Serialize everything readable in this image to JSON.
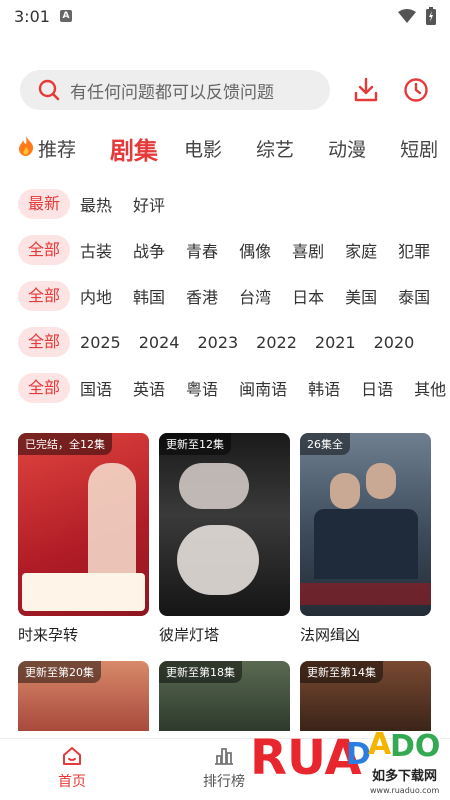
{
  "status": {
    "time": "3:01",
    "notif": "A"
  },
  "search": {
    "placeholder": "有任何问题都可以反馈问题"
  },
  "tabs": [
    {
      "label": "推荐"
    },
    {
      "label": "剧集"
    },
    {
      "label": "电影"
    },
    {
      "label": "综艺"
    },
    {
      "label": "动漫"
    },
    {
      "label": "短剧"
    }
  ],
  "filters": {
    "sort": {
      "active": "最新",
      "options": [
        "最热",
        "好评"
      ]
    },
    "genre": {
      "active": "全部",
      "options": [
        "古装",
        "战争",
        "青春",
        "偶像",
        "喜剧",
        "家庭",
        "犯罪"
      ]
    },
    "region": {
      "active": "全部",
      "options": [
        "内地",
        "韩国",
        "香港",
        "台湾",
        "日本",
        "美国",
        "泰国"
      ]
    },
    "year": {
      "active": "全部",
      "options": [
        "2025",
        "2024",
        "2023",
        "2022",
        "2021",
        "2020"
      ]
    },
    "language": {
      "active": "全部",
      "options": [
        "国语",
        "英语",
        "粤语",
        "闽南语",
        "韩语",
        "日语",
        "其他"
      ]
    }
  },
  "cards": [
    {
      "badge": "已完结，全12集",
      "title": "时来孕转",
      "color": "#c8232c"
    },
    {
      "badge": "更新至12集",
      "title": "彼岸灯塔",
      "color": "#2b2b2b"
    },
    {
      "badge": "26集全",
      "title": "法网缉凶",
      "color": "#4a5968"
    }
  ],
  "cards_row2": [
    {
      "badge": "更新至第20集",
      "color": "#b8574a"
    },
    {
      "badge": "更新至第18集",
      "color": "#3d4a3a"
    },
    {
      "badge": "更新至第14集",
      "color": "#5a3a2a"
    }
  ],
  "nav": {
    "home": "首页",
    "rank": "排行榜"
  },
  "watermark": {
    "brand": "RUADADO",
    "cn": "如多下载网",
    "url": "www.ruaduo.com"
  },
  "colors": {
    "accent": "#e63a3a",
    "chip_bg": "#fde4e4"
  }
}
